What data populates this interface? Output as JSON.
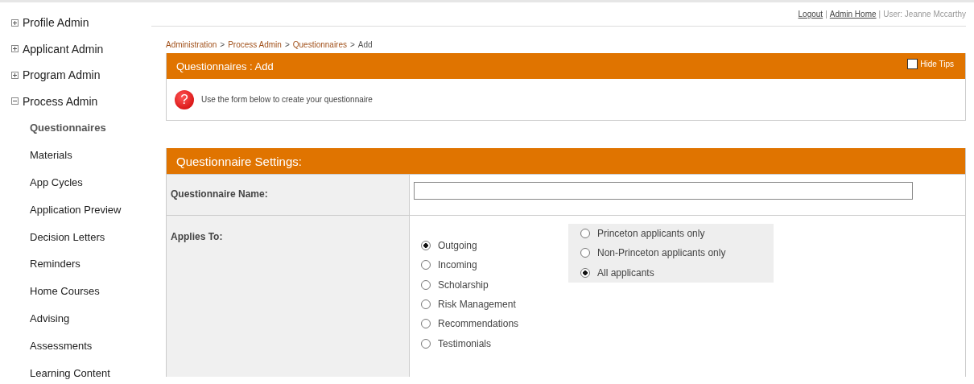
{
  "sidebar": {
    "items": [
      {
        "label": "Profile Admin",
        "expanded": false
      },
      {
        "label": "Applicant Admin",
        "expanded": false
      },
      {
        "label": "Program Admin",
        "expanded": false
      },
      {
        "label": "Process Admin",
        "expanded": true,
        "children": [
          {
            "label": "Questionnaires",
            "selected": true
          },
          {
            "label": "Materials",
            "selected": false
          },
          {
            "label": "App Cycles",
            "selected": false
          },
          {
            "label": "Application Preview",
            "selected": false
          },
          {
            "label": "Decision Letters",
            "selected": false
          },
          {
            "label": "Reminders",
            "selected": false
          },
          {
            "label": "Home Courses",
            "selected": false
          },
          {
            "label": "Advising",
            "selected": false
          },
          {
            "label": "Assessments",
            "selected": false
          },
          {
            "label": "Learning Content",
            "selected": false
          }
        ]
      }
    ]
  },
  "top_links": [
    {
      "kind": "link",
      "label": "Logout"
    },
    {
      "kind": "separator",
      "label": "|"
    },
    {
      "kind": "link",
      "label": "Admin Home"
    },
    {
      "kind": "separator",
      "label": "|"
    },
    {
      "kind": "text",
      "label": "User: Jeanne Mccarthy"
    }
  ],
  "breadcrumb": [
    {
      "kind": "link",
      "label": "Administration"
    },
    {
      "kind": "separator",
      "label": ">"
    },
    {
      "kind": "link",
      "label": "Process Admin"
    },
    {
      "kind": "separator",
      "label": ">"
    },
    {
      "kind": "link",
      "label": "Questionnaires"
    },
    {
      "kind": "separator",
      "label": ">"
    },
    {
      "kind": "current",
      "label": "Add"
    }
  ],
  "panel": {
    "title": "Questionnaires : Add",
    "hide_tips": {
      "label": "Hide Tips",
      "checked": false
    },
    "tip_icon": "?",
    "tip": "Use the form below to create your questionnaire"
  },
  "settings": {
    "title": "Questionnaire Settings:",
    "name_label": "Questionnaire Name:",
    "applies_label": "Applies To:",
    "applies_options": [
      {
        "label": "Outgoing",
        "selected": true
      },
      {
        "label": "Incoming",
        "selected": false
      },
      {
        "label": "Scholarship",
        "selected": false
      },
      {
        "label": "Risk Management",
        "selected": false
      },
      {
        "label": "Recommendations",
        "selected": false
      },
      {
        "label": "Testimonials",
        "selected": false
      }
    ],
    "audience_options": [
      {
        "label": "Princeton applicants only",
        "selected": false
      },
      {
        "label": "Non-Princeton applicants only",
        "selected": false
      },
      {
        "label": "All applicants",
        "selected": true
      }
    ]
  }
}
